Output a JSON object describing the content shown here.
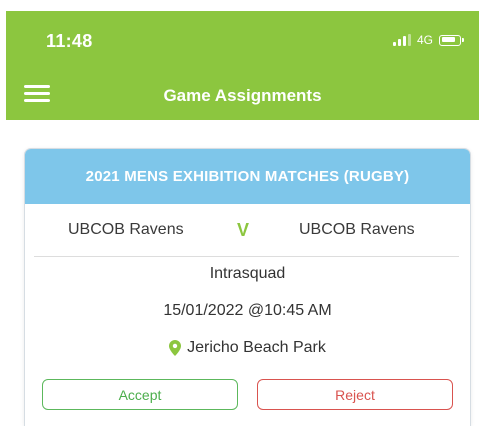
{
  "status_bar": {
    "time": "11:48",
    "network": "4G"
  },
  "header": {
    "title": "Game Assignments"
  },
  "assignment": {
    "competition": "2021 MENS EXHIBITION MATCHES (RUGBY)",
    "home_team": "UBCOB Ravens",
    "versus": "V",
    "away_team": "UBCOB Ravens",
    "game_type": "Intrasquad",
    "datetime": "15/01/2022 @10:45 AM",
    "venue": "Jericho Beach Park",
    "accept_label": "Accept",
    "reject_label": "Reject"
  },
  "colors": {
    "brand_green": "#8cc63f",
    "card_header_blue": "#7ec6ea",
    "accept_green": "#5cb85c",
    "reject_red": "#d9534f"
  },
  "icons": {
    "menu": "hamburger-menu-icon",
    "signal": "signal-strength-icon",
    "battery": "battery-icon",
    "venue": "map-pin-icon"
  }
}
